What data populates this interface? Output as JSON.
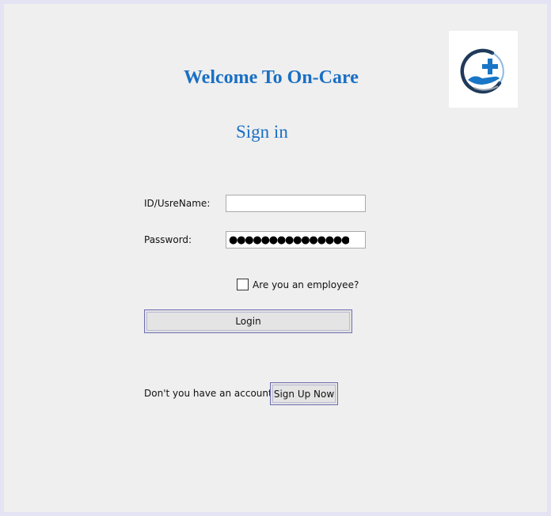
{
  "header": {
    "welcome_title": "Welcome To On-Care",
    "signin_title": "Sign in"
  },
  "logo": {
    "icon": "medical-hand-cross-logo",
    "colors": {
      "primary": "#1976c6",
      "dark": "#1f3a5a"
    }
  },
  "form": {
    "id_label": "ID/UsreName:",
    "id_value": "",
    "password_label": "Password:",
    "password_value_masked": "●●●●●●●●●●●●●●●",
    "employee_checkbox": {
      "label": "Are you an employee?",
      "checked": false
    },
    "login_label": "Login"
  },
  "signup": {
    "prompt": "Don't you have an account",
    "button_label": "Sign Up Now"
  },
  "colors": {
    "background": "#efefef",
    "title": "#1a6fc4",
    "button_border": "#6d6db0"
  }
}
